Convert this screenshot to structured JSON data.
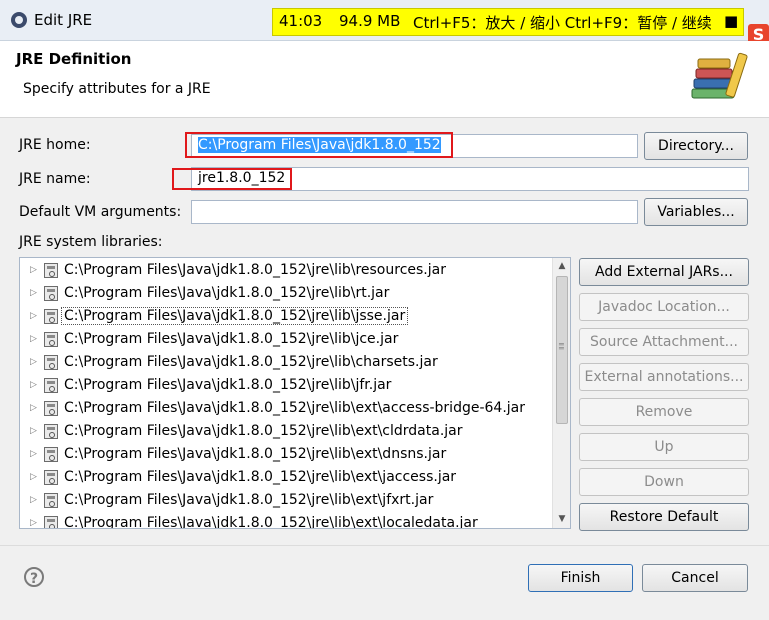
{
  "window": {
    "title": "Edit JRE"
  },
  "recorder": {
    "time": "41:03",
    "size": "94.9 MB",
    "hint": "Ctrl+F5：放大 / 缩小 Ctrl+F9：暂停 / 继续",
    "stop_symbol": "■"
  },
  "tray": {
    "logo_letter": "S"
  },
  "header": {
    "title": "JRE Definition",
    "subtitle": "Specify attributes for a JRE"
  },
  "form": {
    "jre_home_label": "JRE home:",
    "jre_home_value": "C:\\Program Files\\Java\\jdk1.8.0_152",
    "directory_button": "Directory...",
    "jre_name_label": "JRE name:",
    "jre_name_value": "jre1.8.0_152",
    "vm_args_label": "Default VM arguments:",
    "vm_args_value": "",
    "variables_button": "Variables...",
    "libraries_label": "JRE system libraries:"
  },
  "libraries": [
    "C:\\Program Files\\Java\\jdk1.8.0_152\\jre\\lib\\resources.jar",
    "C:\\Program Files\\Java\\jdk1.8.0_152\\jre\\lib\\rt.jar",
    "C:\\Program Files\\Java\\jdk1.8.0_152\\jre\\lib\\jsse.jar",
    "C:\\Program Files\\Java\\jdk1.8.0_152\\jre\\lib\\jce.jar",
    "C:\\Program Files\\Java\\jdk1.8.0_152\\jre\\lib\\charsets.jar",
    "C:\\Program Files\\Java\\jdk1.8.0_152\\jre\\lib\\jfr.jar",
    "C:\\Program Files\\Java\\jdk1.8.0_152\\jre\\lib\\ext\\access-bridge-64.jar",
    "C:\\Program Files\\Java\\jdk1.8.0_152\\jre\\lib\\ext\\cldrdata.jar",
    "C:\\Program Files\\Java\\jdk1.8.0_152\\jre\\lib\\ext\\dnsns.jar",
    "C:\\Program Files\\Java\\jdk1.8.0_152\\jre\\lib\\ext\\jaccess.jar",
    "C:\\Program Files\\Java\\jdk1.8.0_152\\jre\\lib\\ext\\jfxrt.jar",
    "C:\\Program Files\\Java\\jdk1.8.0_152\\jre\\lib\\ext\\localedata.jar"
  ],
  "selected_library_index": 2,
  "side_buttons": {
    "add_external": "Add External JARs...",
    "javadoc": "Javadoc Location...",
    "source": "Source Attachment...",
    "annotations": "External annotations...",
    "remove": "Remove",
    "up": "Up",
    "down": "Down",
    "restore": "Restore Default"
  },
  "footer": {
    "help_symbol": "?",
    "finish": "Finish",
    "cancel": "Cancel"
  },
  "colors": {
    "selection": "#3399ff",
    "highlight_box": "#e0181b",
    "recorder_bg": "#ffff00"
  }
}
